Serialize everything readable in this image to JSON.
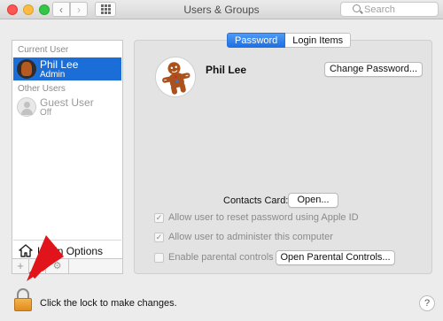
{
  "window": {
    "title": "Users & Groups",
    "nav_back_glyph": "‹",
    "nav_forward_glyph": "›",
    "search_placeholder": "Search"
  },
  "sidebar": {
    "current_user_header": "Current User",
    "current_user": {
      "name": "Phil Lee",
      "role": "Admin",
      "avatar_icon": "gingerbread-icon"
    },
    "other_users_header": "Other Users",
    "other_users": [
      {
        "name": "Guest User",
        "role": "Off",
        "avatar_icon": "guest-silhouette-icon"
      }
    ],
    "login_options_label": "Login Options",
    "toolbar": {
      "add_glyph": "+",
      "remove_glyph": "−",
      "gear_glyph": "⚙"
    }
  },
  "tabs": [
    {
      "label": "Password",
      "active": true
    },
    {
      "label": "Login Items",
      "active": false
    }
  ],
  "detail": {
    "user_name": "Phil Lee",
    "change_password_button": "Change Password...",
    "contacts_card_label": "Contacts Card:",
    "open_button": "Open...",
    "options": [
      {
        "label": "Allow user to reset password using Apple ID",
        "checked": true
      },
      {
        "label": "Allow user to administer this computer",
        "checked": true
      },
      {
        "label": "Enable parental controls",
        "checked": false
      }
    ],
    "open_parental_controls_button": "Open Parental Controls..."
  },
  "footer": {
    "lock_text": "Click the lock to make changes.",
    "help_glyph": "?"
  },
  "colors": {
    "selection": "#1b6ed8",
    "lock": "#e9a13a",
    "arrow": "#e0141a"
  }
}
